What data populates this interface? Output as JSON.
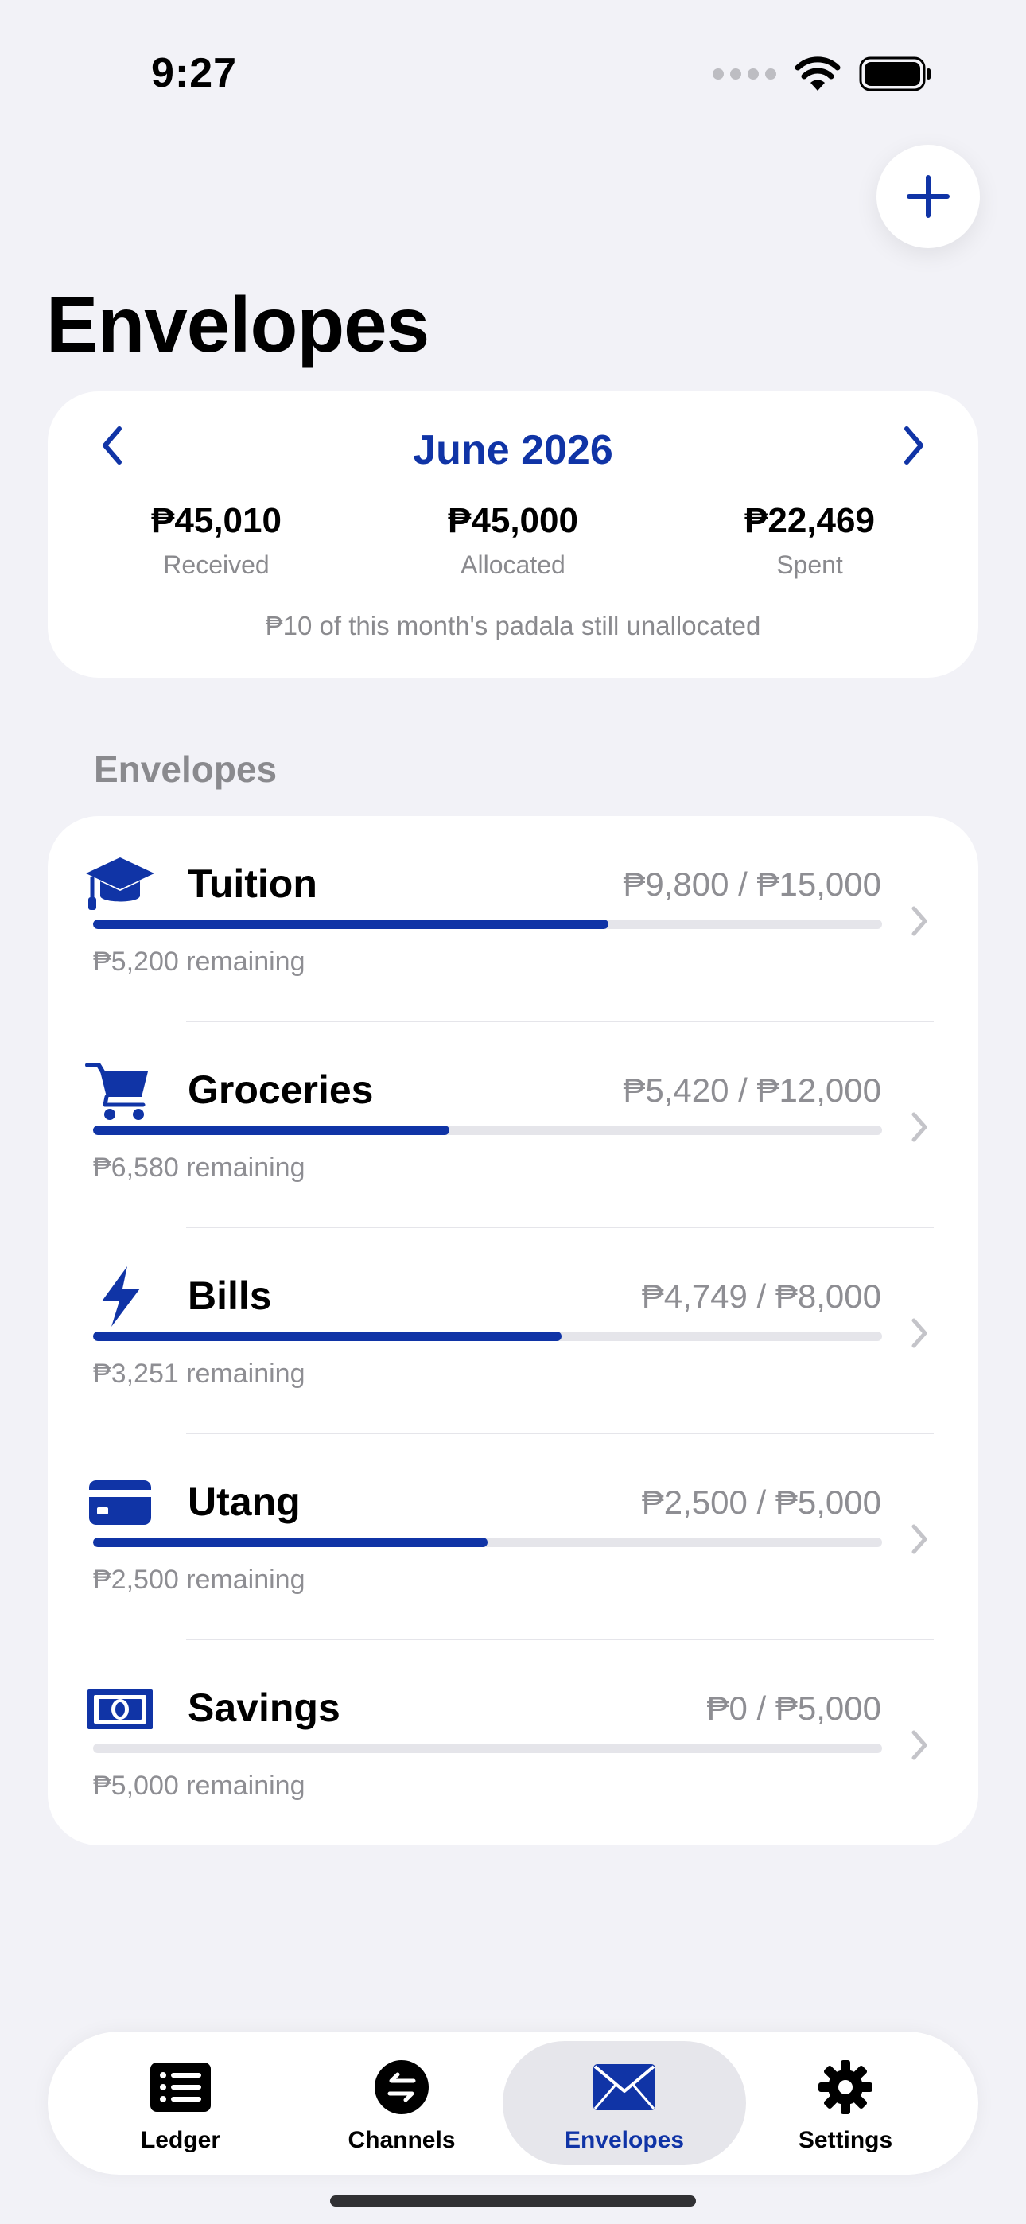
{
  "status_bar": {
    "time": "9:27"
  },
  "header": {
    "title": "Envelopes"
  },
  "month_card": {
    "month": "June 2026",
    "stats": [
      {
        "value": "₱45,010",
        "label": "Received"
      },
      {
        "value": "₱45,000",
        "label": "Allocated"
      },
      {
        "value": "₱22,469",
        "label": "Spent"
      }
    ],
    "note": "₱10 of this month's padala still unallocated"
  },
  "section_header": "Envelopes",
  "envelopes": [
    {
      "name": "Tuition",
      "icon": "graduation-cap-icon",
      "amount": "₱9,800 / ₱15,000",
      "remaining": "₱5,200 remaining",
      "progress": 0.6533
    },
    {
      "name": "Groceries",
      "icon": "cart-icon",
      "amount": "₱5,420 / ₱12,000",
      "remaining": "₱6,580 remaining",
      "progress": 0.4517
    },
    {
      "name": "Bills",
      "icon": "bolt-icon",
      "amount": "₱4,749 / ₱8,000",
      "remaining": "₱3,251 remaining",
      "progress": 0.5936
    },
    {
      "name": "Utang",
      "icon": "credit-card-icon",
      "amount": "₱2,500 / ₱5,000",
      "remaining": "₱2,500 remaining",
      "progress": 0.5
    },
    {
      "name": "Savings",
      "icon": "banknote-icon",
      "amount": "₱0 / ₱5,000",
      "remaining": "₱5,000 remaining",
      "progress": 0
    }
  ],
  "tab_bar": {
    "tabs": [
      {
        "label": "Ledger",
        "icon": "list-icon"
      },
      {
        "label": "Channels",
        "icon": "transfer-icon"
      },
      {
        "label": "Envelopes",
        "icon": "envelope-icon",
        "active": true
      },
      {
        "label": "Settings",
        "icon": "gear-icon"
      }
    ]
  },
  "colors": {
    "accent": "#1034A6",
    "background": "#F2F2F7",
    "track": "#E5E5EA"
  }
}
